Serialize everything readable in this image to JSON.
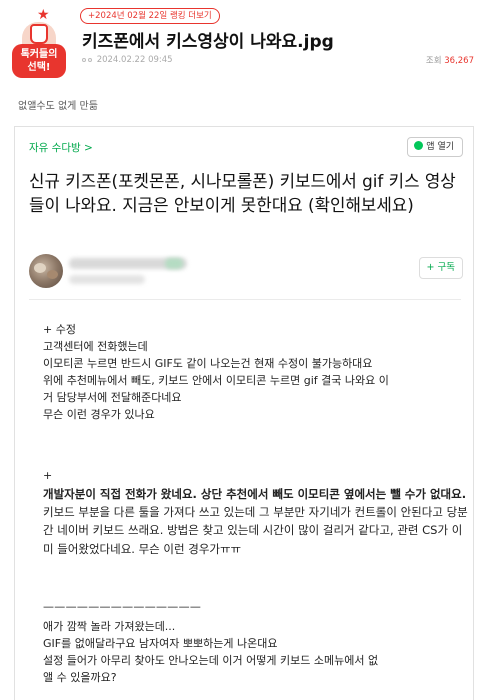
{
  "badge": {
    "label": "톡커들의\n선택!"
  },
  "header": {
    "tag": "+2024년 02월 22일 랭킹 더보기",
    "title": "키즈폰에서 키스영상이 나와요.jpg",
    "date": "2024.02.22 09:45",
    "views_label": "조회",
    "views_count": "36,267"
  },
  "subtitle": "없앨수도 없게 만듦",
  "card": {
    "cafe_name": "자유 수다방 >",
    "app_button": "앱 열기",
    "post_title": "신규 키즈폰(포켓몬폰, 시나모롤폰) 키보드에서 gif 키스 영상들이 나와요. 지금은 안보이게 못한대요 (확인해보세요)",
    "subscribe": "+ 구독",
    "para1": "+ 수정\n고객센터에 전화했는데\n이모티콘 누르면 반드시 GIF도 같이 나오는건 현재 수정이 불가능하대요\n위에 추천메뉴에서 빼도, 키보드 안에서 이모티콘 누르면 gif 결국 나와요 이\n거 담당부서에 전달해준다네요\n무슨 이런 경우가 있나요",
    "plus": "+",
    "bold_part": "개발자분이 직접 전화가 왔네요. 상단 추천에서 빼도 이모티콘 옆에서는 뺄 수가 없대요.",
    "normal_part": " 키보드 부분을 다른 툴을 가져다 쓰고 있는데 그 부분만 자기네가 컨트롤이 안된다고 당분간 네이버 키보드 쓰래요. 방법은 찾고 있는데 시간이 많이 걸리거 같다고, 관련 CS가 이미 들어왔었다네요. 무슨 이런 경우가ㅠㅠ",
    "rule": "——————————————",
    "para3": "애가 깜짝 놀라 가져왔는데...\nGIF를 없애달라구요 남자여자 뽀뽀하는게 나온대요\n설정 들어가 아무리 찾아도 안나오는데 이거 어떻게 키보드 소메뉴에서 없\n앨 수 있을까요?"
  }
}
